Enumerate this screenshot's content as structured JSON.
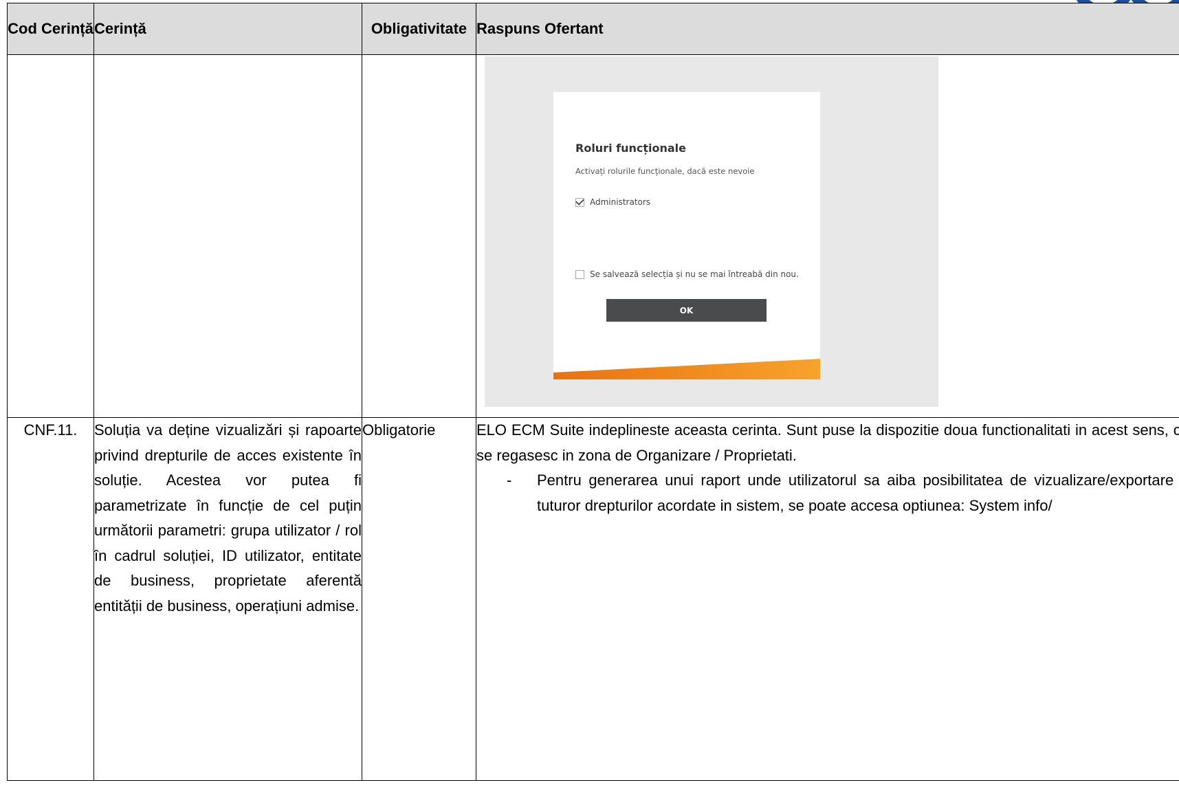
{
  "table": {
    "headers": {
      "code": "Cod Cerință",
      "requirement": "Cerință",
      "mandatory": "Obligativitate",
      "response": "Raspuns Ofertant"
    },
    "rows": [
      {
        "code": "",
        "requirement": "",
        "mandatory": "",
        "screenshot": {
          "title": "Roluri funcționale",
          "subtitle": "Activați rolurile funcționale, dacă este nevoie",
          "role_option": {
            "label": "Administrators",
            "checked": true
          },
          "save_option": {
            "label": "Se salvează selecția și nu se mai întreabă din nou.",
            "checked": false
          },
          "ok_label": "OK",
          "accent_color": "#f28a1e"
        }
      },
      {
        "code": "CNF.11.",
        "requirement": "Soluția va deține vizualizări și rapoarte privind drepturile de acces existente în soluție. Acestea vor putea fi parametrizate în funcție de cel puțin următorii parametri: grupa utilizator / rol în cadrul soluției, ID utilizator, entitate de business, proprietate aferentă entității de business, operațiuni admise.",
        "mandatory": "Obligatorie",
        "response_intro": "ELO ECM Suite indeplineste aceasta cerinta. Sunt puse la dispozitie doua functionalitati in acest sens, ce se regasesc in zona de Organizare / Proprietati.",
        "response_items": [
          "Pentru generarea unui raport unde utilizatorul sa aiba posibilitatea de vizualizare/exportare a tuturor drepturilor acordate in sistem, se poate accesa optiunea: System info/"
        ]
      }
    ]
  },
  "logo_color": "#1a4f9c"
}
